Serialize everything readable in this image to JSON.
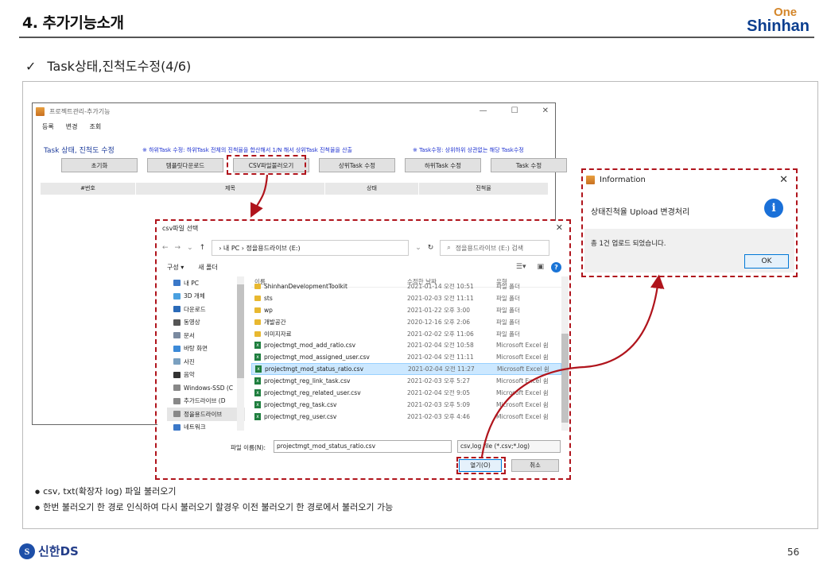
{
  "slide": {
    "title": "4. 추가기능소개",
    "subtitle_check": "✓",
    "subtitle": "Task상태,진척도수정(4/6)",
    "logo_top": "One",
    "logo_brand": "Shinhan",
    "page_number": "56",
    "footer_brand": "신한DS"
  },
  "app_window": {
    "title": "프로젝트관리-추가기능",
    "controls": [
      "—",
      "☐",
      "✕"
    ],
    "menu": [
      "등록",
      "변경",
      "조회"
    ],
    "section_title": "Task 상태, 진척도 수정",
    "note_left": "※ 하위Task 수정:  하위Task 전체의 진척율을 합산해서 1/N 해서 상위Task 진척율을 산출",
    "note_right": "※ Task수정: 상위하위 상관없는 해당 Task수정",
    "buttons": [
      "초기화",
      "템플릿다운로드",
      "CSV파일불러오기",
      "상위Task 수정",
      "하위Task 수정",
      "Task 수정"
    ],
    "grid_columns": [
      "#번호",
      "제목",
      "상태",
      "진척율"
    ]
  },
  "file_dialog": {
    "title": "csv파일 선택",
    "close": "✕",
    "path": "›  내 PC  ›  정을용드라이브 (E:)",
    "search_placeholder": "정을용드라이브 (E:) 검색",
    "organize": "구성 ▾",
    "new_folder": "새 폴더",
    "help": "?",
    "nav_items": [
      {
        "label": "내 PC",
        "color": "#3b78c8"
      },
      {
        "label": "3D 개체",
        "color": "#4aa0e0"
      },
      {
        "label": "다운로드",
        "color": "#2a6ab8"
      },
      {
        "label": "동영상",
        "color": "#555555"
      },
      {
        "label": "문서",
        "color": "#7a8aa0"
      },
      {
        "label": "바탕 화면",
        "color": "#3c8ad8"
      },
      {
        "label": "사진",
        "color": "#7aa0c0"
      },
      {
        "label": "음악",
        "color": "#333333"
      },
      {
        "label": "Windows-SSD (C",
        "color": "#888888"
      },
      {
        "label": "추가드라이브 (D",
        "color": "#888888"
      },
      {
        "label": "정을용드라이브",
        "color": "#888888"
      },
      {
        "label": "네트워크",
        "color": "#3b78c8"
      }
    ],
    "columns": [
      "이름",
      "수정한 날짜",
      "유형"
    ],
    "files": [
      {
        "name": "ShinhanDevelopmentToolkit",
        "date": "2021-01-14 오전 10:51",
        "type": "파일 폴더",
        "kind": "folder"
      },
      {
        "name": "sts",
        "date": "2021-02-03 오전 11:11",
        "type": "파일 폴더",
        "kind": "folder"
      },
      {
        "name": "wp",
        "date": "2021-01-22 오후 3:00",
        "type": "파일 폴더",
        "kind": "folder"
      },
      {
        "name": "개발공간",
        "date": "2020-12-16 오후 2:06",
        "type": "파일 폴더",
        "kind": "folder"
      },
      {
        "name": "이미지자료",
        "date": "2021-02-02 오후 11:06",
        "type": "파일 폴더",
        "kind": "folder"
      },
      {
        "name": "projectmgt_mod_add_ratio.csv",
        "date": "2021-02-04 오전 10:58",
        "type": "Microsoft Excel 쉼",
        "kind": "xls"
      },
      {
        "name": "projectmgt_mod_assigned_user.csv",
        "date": "2021-02-04 오전 11:11",
        "type": "Microsoft Excel 쉼",
        "kind": "xls"
      },
      {
        "name": "projectmgt_mod_status_ratio.csv",
        "date": "2021-02-04 오전 11:27",
        "type": "Microsoft Excel 쉼",
        "kind": "xls",
        "selected": true
      },
      {
        "name": "projectmgt_reg_link_task.csv",
        "date": "2021-02-03 오후 5:27",
        "type": "Microsoft Excel 쉼",
        "kind": "xls"
      },
      {
        "name": "projectmgt_reg_related_user.csv",
        "date": "2021-02-04 오전 9:05",
        "type": "Microsoft Excel 쉼",
        "kind": "xls"
      },
      {
        "name": "projectmgt_reg_task.csv",
        "date": "2021-02-03 오후 5:09",
        "type": "Microsoft Excel 쉼",
        "kind": "xls"
      },
      {
        "name": "projectmgt_reg_user.csv",
        "date": "2021-02-03 오후 4:46",
        "type": "Microsoft Excel 쉼",
        "kind": "xls"
      }
    ],
    "filename_label": "파일 이름(N):",
    "filename_value": "projectmgt_mod_status_ratio.csv",
    "filter_value": "csv,log file (*.csv;*.log)",
    "open_label": "열기(O)",
    "cancel_label": "취소"
  },
  "info_dialog": {
    "title": "Information",
    "close": "✕",
    "message": "상태진척율 Upload 변경처리",
    "icon": "i",
    "count_message": "총 1건 업로드 되었습니다.",
    "ok_label": "OK"
  },
  "bullets": [
    "csv, txt(확장자 log) 파일 불러오기",
    "한번 불러오기 한 경로 인식하여 다시 불러오기 할경우 이전 불러오기 한 경로에서 불러오기 가능"
  ],
  "colors": {
    "highlight": "#b0141c",
    "accent_blue": "#1b3a9a",
    "selection": "#cce8ff"
  }
}
